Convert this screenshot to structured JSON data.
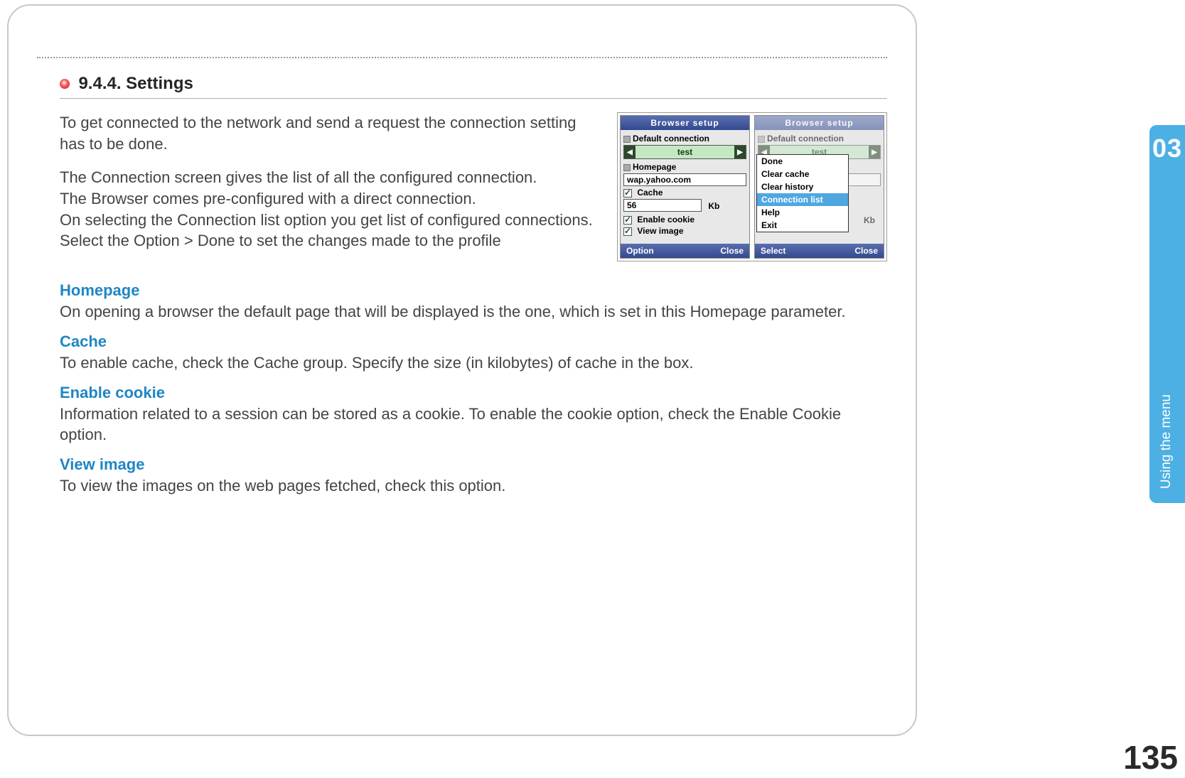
{
  "chapter": {
    "number": "03",
    "title": "Using the menu"
  },
  "page_number": "135",
  "heading": "9.4.4. Settings",
  "intro": {
    "p1": "To get connected to the network and send a request the connection setting has to be done.",
    "p2a": "The Connection screen gives the list of all the configured connection.",
    "p2b": "The Browser comes pre-configured with a direct connection.",
    "p2c": "On selecting the Connection list option you get list of configured connections.",
    "p2d": "Select the Option > Done to set the changes made to the profile"
  },
  "defs": {
    "homepage": {
      "term": "Homepage",
      "desc": "On opening a browser the default page that will be displayed is the one, which is set in this Homepage parameter."
    },
    "cache": {
      "term": "Cache",
      "desc": "To enable cache, check the Cache group. Specify the size (in kilobytes) of cache in the box."
    },
    "cookie": {
      "term": "Enable cookie",
      "desc": "Information related to a session can be stored as a cookie. To enable the cookie option, check the Enable Cookie option."
    },
    "viewimg": {
      "term": "View image",
      "desc": "To view the images on the web pages fetched, check this option."
    }
  },
  "phone": {
    "title": "Browser setup",
    "default_connection_label": "Default connection",
    "selector_value": "test",
    "homepage_label": "Homepage",
    "homepage_value": "wap.yahoo.com",
    "cache_label": "Cache",
    "cache_value": "56",
    "cache_unit": "Kb",
    "enable_cookie_label": "Enable cookie",
    "view_image_label": "View image",
    "soft_left_a": "Option",
    "soft_right_a": "Close",
    "soft_left_b": "Select",
    "soft_right_b": "Close",
    "menu": {
      "done": "Done",
      "clear_cache": "Clear cache",
      "clear_history": "Clear history",
      "connection_list": "Connection list",
      "help": "Help",
      "exit": "Exit"
    }
  }
}
